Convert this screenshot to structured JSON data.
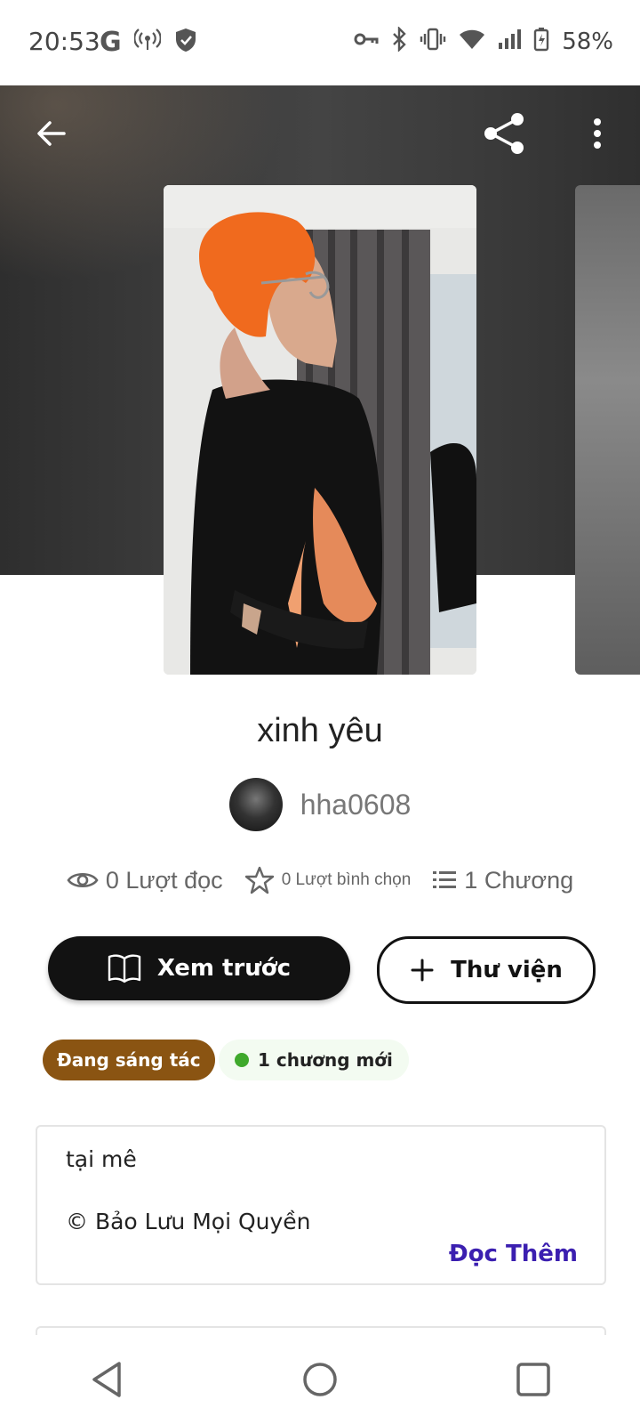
{
  "status_bar": {
    "time": "20:53",
    "google_letter": "G",
    "battery": "58%",
    "icons_left": [
      "google-icon",
      "hotspot-icon",
      "shield-icon"
    ],
    "icons_right": [
      "vpn-key-icon",
      "bluetooth-icon",
      "vibrate-icon",
      "wifi-icon",
      "signal-icon",
      "battery-charging-icon"
    ]
  },
  "header": {
    "back_icon": "arrow-left-icon",
    "share_icon": "share-icon",
    "more_icon": "more-vertical-icon"
  },
  "story": {
    "title": "xinh yêu",
    "author": "hha0608",
    "reads": "0 Lượt đọc",
    "votes": "0 Lượt bình chọn",
    "chapters": "1 Chương"
  },
  "actions": {
    "preview_label": "Xem trước",
    "library_label": "Thư viện"
  },
  "badges": {
    "status": "Đang sáng tác",
    "new_chapters": "1 chương mới"
  },
  "description": {
    "line1": "tại mê",
    "line2": "© Bảo Lưu Mọi Quyền",
    "read_more": "Đọc Thêm"
  },
  "colors": {
    "status_badge": "#8a5412",
    "new_badge_bg": "#f3fbf1",
    "green_dot": "#3fa92c",
    "read_more": "#3b1fb0",
    "primary_button": "#121212"
  }
}
